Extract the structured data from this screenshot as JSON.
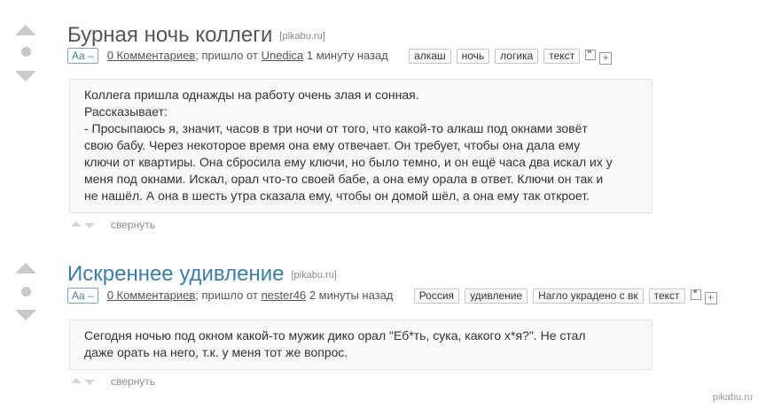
{
  "colors": {
    "title_gray": "#555555",
    "title_blue": "#3d7ea6",
    "vote_gray": "#c9c9c9",
    "box_bg": "#f7f8f9"
  },
  "posts": [
    {
      "title": "Бурная ночь коллеги",
      "source": "[pikabu.ru]",
      "aa": "Aa –",
      "comments": "0 Комментариев",
      "came_from": "; пришло от ",
      "author": "Unedica",
      "time": " 1 минуту назад",
      "tags": [
        "алкаш",
        "ночь",
        "логика",
        "текст"
      ],
      "lines": [
        "Коллега пришла однажды на работу очень злая и сонная.",
        "Рассказывает:",
        "- Просыпаюсь я, значит, часов в три ночи от того, что какой-то алкаш под окнами зовёт",
        "свою бабу. Через некоторое время она ему отвечает. Он требует, чтобы она дала ему",
        "ключи от квартиры. Она сбросила ему ключи, но было темно, и он ещё часа два искал их у",
        "меня под окнами. Искал, орал что-то своей бабе, а она ему орала в ответ. Ключи он так и",
        "не нашёл. А она в шесть утра сказала ему, чтобы он домой шёл, а она ему так откроет."
      ],
      "collapse": "свернуть"
    },
    {
      "title": "Искреннее удивление",
      "source": "[pikabu.ru]",
      "aa": "Aa –",
      "comments": "0 Комментариев",
      "came_from": "; пришло от ",
      "author": "nester46",
      "time": " 2 минуты назад",
      "tags": [
        "Россия",
        "удивление",
        "Нагло украдено с вк",
        "текст"
      ],
      "lines": [
        "Сегодня ночью под окном какой-то мужик дико орал \"Еб*ть, сука, какого х*я?\". Не стал",
        "даже орать на него, т.к. у меня тот же вопрос."
      ],
      "collapse": "свернуть"
    }
  ],
  "watermark": "pikabu.ru"
}
